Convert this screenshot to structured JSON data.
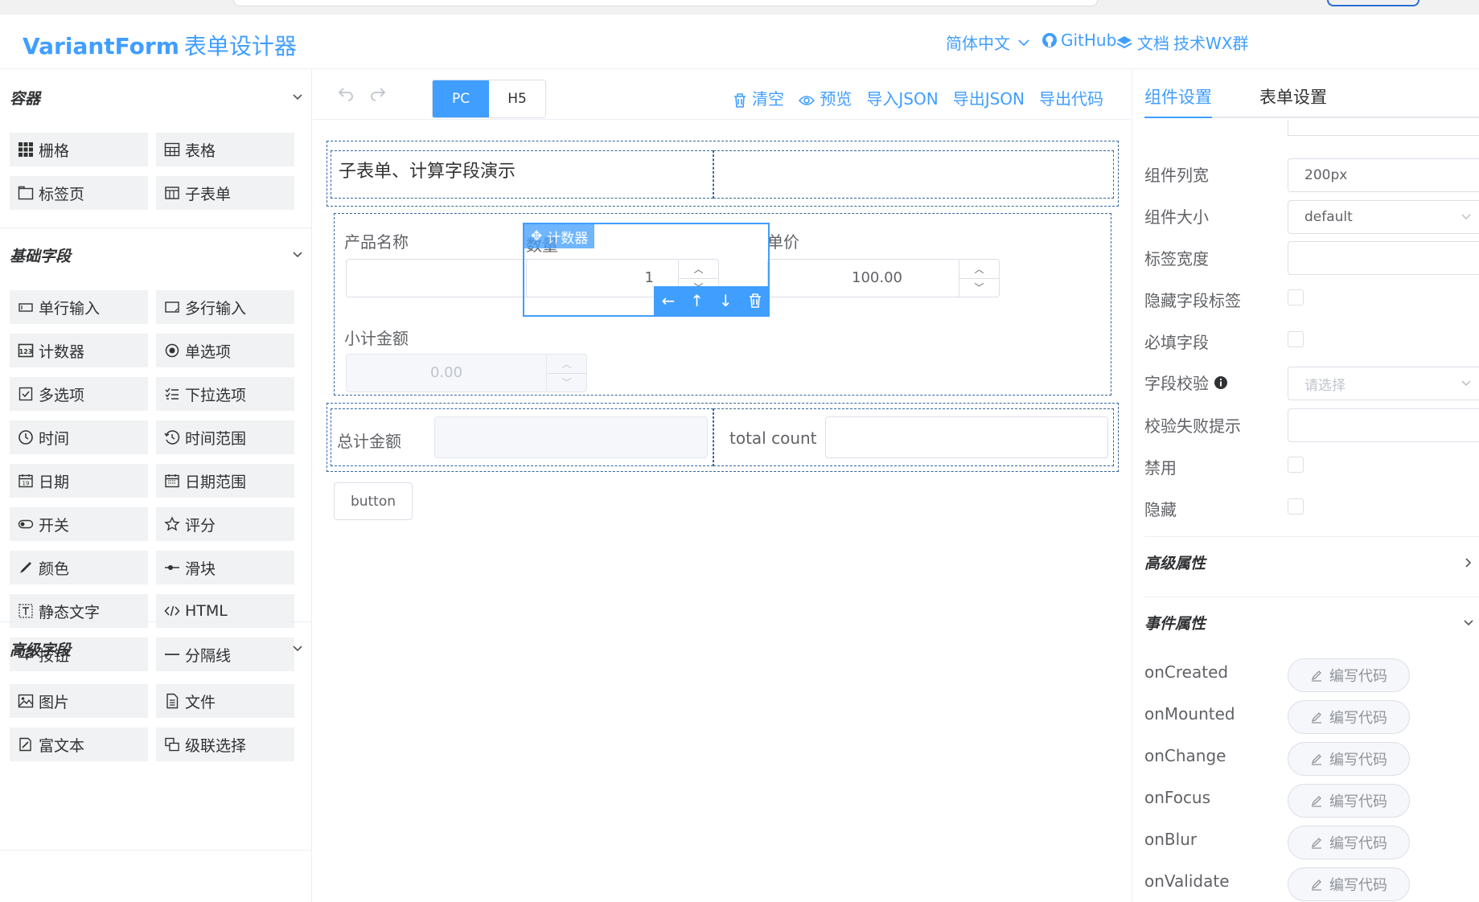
{
  "header": {
    "brand": "VariantForm",
    "brand_sub": "表单设计器",
    "lang": "简体中文",
    "github": "GitHub",
    "docs": "文档",
    "wx": "技术WX群"
  },
  "left": {
    "groups": [
      {
        "title": "容器",
        "items": [
          {
            "label": "栅格",
            "icon": "grid-icon"
          },
          {
            "label": "表格",
            "icon": "table-icon"
          },
          {
            "label": "标签页",
            "icon": "tabs-icon"
          },
          {
            "label": "子表单",
            "icon": "subform-icon"
          }
        ]
      },
      {
        "title": "基础字段",
        "items": [
          {
            "label": "单行输入",
            "icon": "input-icon"
          },
          {
            "label": "多行输入",
            "icon": "textarea-icon"
          },
          {
            "label": "计数器",
            "icon": "number-icon"
          },
          {
            "label": "单选项",
            "icon": "radio-icon"
          },
          {
            "label": "多选项",
            "icon": "checkbox-icon"
          },
          {
            "label": "下拉选项",
            "icon": "select-icon"
          },
          {
            "label": "时间",
            "icon": "time-icon"
          },
          {
            "label": "时间范围",
            "icon": "time-range-icon"
          },
          {
            "label": "日期",
            "icon": "date-icon"
          },
          {
            "label": "日期范围",
            "icon": "date-range-icon"
          },
          {
            "label": "开关",
            "icon": "switch-icon"
          },
          {
            "label": "评分",
            "icon": "star-icon"
          },
          {
            "label": "颜色",
            "icon": "color-icon"
          },
          {
            "label": "滑块",
            "icon": "slider-icon"
          },
          {
            "label": "静态文字",
            "icon": "static-text-icon"
          },
          {
            "label": "HTML",
            "icon": "html-icon"
          },
          {
            "label": "按钮",
            "icon": "button-icon"
          },
          {
            "label": "分隔线",
            "icon": "divider-icon"
          }
        ]
      },
      {
        "title": "高级字段",
        "items": [
          {
            "label": "图片",
            "icon": "picture-icon"
          },
          {
            "label": "文件",
            "icon": "file-icon"
          },
          {
            "label": "富文本",
            "icon": "rich-text-icon"
          },
          {
            "label": "级联选择",
            "icon": "cascader-icon"
          }
        ]
      }
    ]
  },
  "toolbar": {
    "pc": "PC",
    "h5": "H5",
    "clear": "清空",
    "preview": "预览",
    "import_json": "导入JSON",
    "export_json": "导出JSON",
    "export_code": "导出代码"
  },
  "canvas": {
    "title": "子表单、计算字段演示",
    "product_name": "产品名称",
    "quantity": "数量",
    "unit_price": "单价",
    "counter_tag": "计数器",
    "quantity_value": "1",
    "price_value": "100.00",
    "subtotal": "小计金额",
    "subtotal_value": "0.00",
    "total_amount": "总计金额",
    "total_count": "total count",
    "button": "button"
  },
  "right": {
    "tab_component": "组件设置",
    "tab_form": "表单设置",
    "props": [
      {
        "label": "组件列宽",
        "value": "200px"
      },
      {
        "label": "组件大小",
        "value": "default"
      },
      {
        "label": "标签宽度",
        "value": ""
      }
    ],
    "hide_label": "隐藏字段标签",
    "required": "必填字段",
    "validation": "字段校验",
    "validation_placeholder": "请选择",
    "validation_hint": "校验失败提示",
    "disabled": "禁用",
    "hidden": "隐藏",
    "advanced": "高级属性",
    "events": "事件属性",
    "event_list": [
      "onCreated",
      "onMounted",
      "onChange",
      "onFocus",
      "onBlur",
      "onValidate"
    ],
    "code_btn": "编写代码"
  },
  "colors": {
    "accent": "#409eff",
    "border": "#dcdfe6",
    "dash": "#336699"
  }
}
